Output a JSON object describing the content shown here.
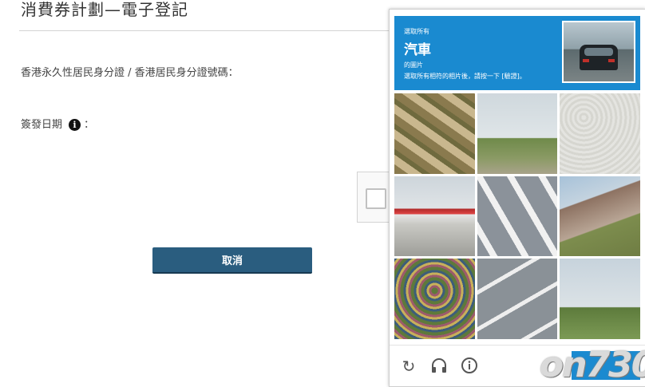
{
  "form": {
    "title": "消費券計劃—電子登記",
    "hkid_label": "香港永久性居民身分證 / 香港居民身分證號碼：",
    "issue_date_label": "簽發日期",
    "issue_date_suffix": "：",
    "info_glyph": "i",
    "cancel_label": "取消"
  },
  "challenge": {
    "line1": "選取所有",
    "target": "汽車",
    "line3": "的圖片",
    "instruction": "選取所有相符的相片後，請按一下 [驗證]。",
    "header_color": "#1a8ad0",
    "tiles": [
      "t0",
      "t1",
      "t2",
      "t3",
      "t4",
      "t5",
      "t6",
      "t7",
      "t8"
    ],
    "footer_icons": [
      "reload-icon",
      "audio-icon",
      "info-icon"
    ],
    "verify_label": ""
  },
  "watermark": {
    "text": "on730"
  },
  "colors": {
    "cancel_button": "#2a5d7f",
    "accent": "#1a8ad0"
  }
}
